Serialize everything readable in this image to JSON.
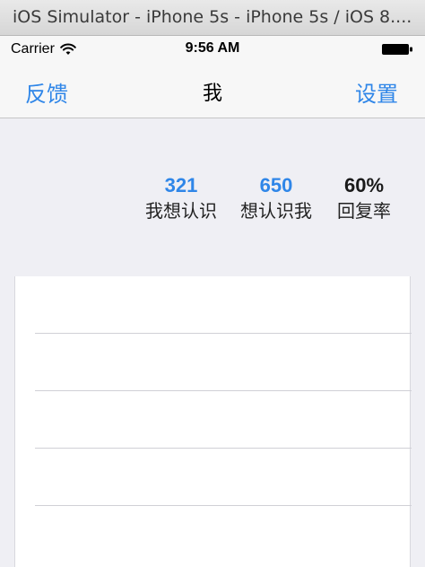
{
  "simulator": {
    "title": "iOS Simulator - iPhone 5s - iPhone 5s / iOS 8...."
  },
  "status_bar": {
    "carrier": "Carrier",
    "time": "9:56 AM",
    "wifi_icon": "wifi-icon",
    "battery_icon": "battery-icon"
  },
  "nav": {
    "left_button": "反馈",
    "title": "我",
    "right_button": "设置"
  },
  "stats": [
    {
      "value": "321",
      "label": "我想认识"
    },
    {
      "value": "650",
      "label": "想认识我"
    },
    {
      "value": "60%",
      "label": "回复率"
    }
  ],
  "list": {
    "rows": [
      "",
      "",
      "",
      "",
      ""
    ]
  },
  "colors": {
    "accent": "#2f86e8",
    "background": "#efeff4",
    "nav_background": "#f7f7f7",
    "separator": "#d0d0d6"
  }
}
